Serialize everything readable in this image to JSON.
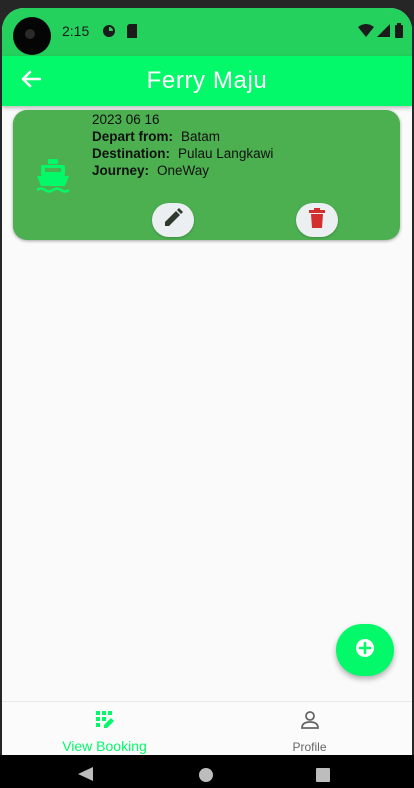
{
  "status_bar": {
    "time": "2:15",
    "icons": [
      "camera-hole",
      "sync-icon",
      "sim-card-icon",
      "wifi-icon",
      "signal-icon",
      "battery-icon"
    ]
  },
  "app_bar": {
    "title": "Ferry Maju",
    "back_icon": "arrow-back-icon"
  },
  "booking": {
    "date": "2023 06 16",
    "depart_label": "Depart from:",
    "depart_value": "Batam",
    "destination_label": "Destination:",
    "destination_value": "Pulau Langkawi",
    "journey_label": "Journey:",
    "journey_value": "OneWay",
    "icon": "ferry-icon"
  },
  "actions": {
    "edit_icon": "pencil-icon",
    "delete_icon": "trash-icon"
  },
  "fab": {
    "icon": "add-circle-icon"
  },
  "bottom_nav": {
    "items": [
      {
        "label": "View Booking",
        "icon": "booking-edit-icon",
        "active": true
      },
      {
        "label": "Profile",
        "icon": "person-icon",
        "active": false
      }
    ]
  },
  "colors": {
    "app_bar": "#04f96a",
    "status_bar": "#24d15c",
    "card": "#4caf50",
    "accent": "#04f96a",
    "delete": "#d32f2f"
  }
}
